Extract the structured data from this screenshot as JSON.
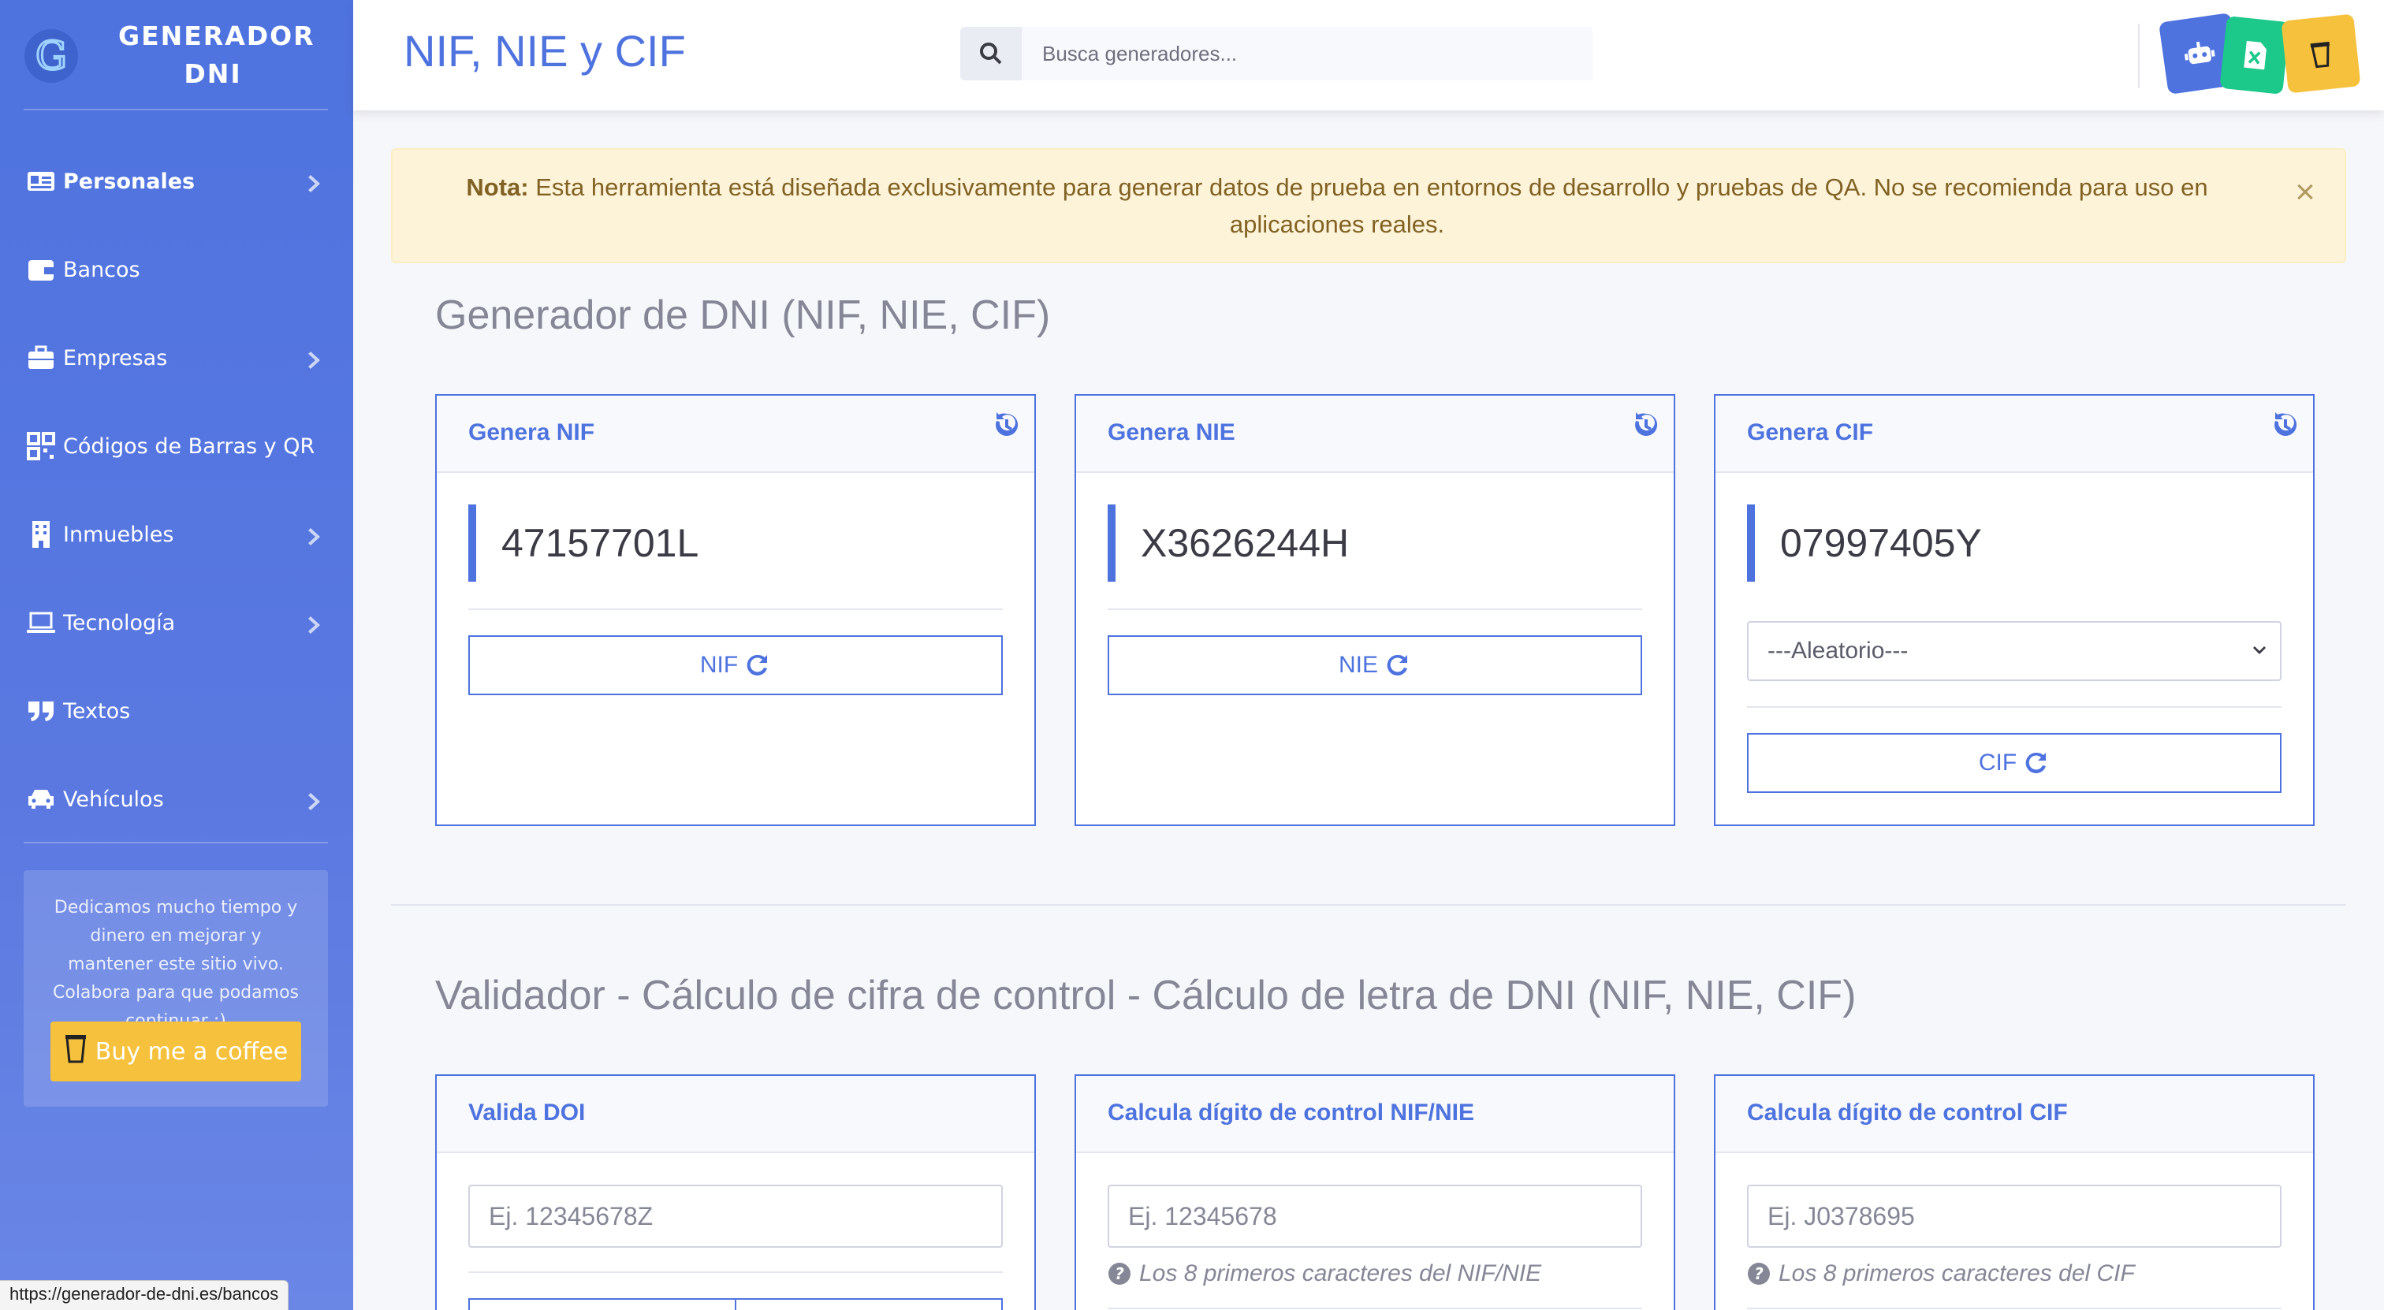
{
  "brand": {
    "name": "GENERADOR DNI"
  },
  "sidebar": {
    "items": [
      {
        "label": "Personales",
        "icon": "id-card-icon",
        "has_submenu": true,
        "active": true
      },
      {
        "label": "Bancos",
        "icon": "wallet-icon",
        "has_submenu": false
      },
      {
        "label": "Empresas",
        "icon": "briefcase-icon",
        "has_submenu": true
      },
      {
        "label": "Códigos de Barras y QR",
        "icon": "qrcode-icon",
        "has_submenu": false
      },
      {
        "label": "Inmuebles",
        "icon": "building-icon",
        "has_submenu": true
      },
      {
        "label": "Tecnología",
        "icon": "laptop-icon",
        "has_submenu": true
      },
      {
        "label": "Textos",
        "icon": "quote-icon",
        "has_submenu": false
      },
      {
        "label": "Vehículos",
        "icon": "car-icon",
        "has_submenu": true
      }
    ],
    "donate_text": "Dedicamos mucho tiempo y dinero en mejorar y mantener este sitio vivo. Colabora para que podamos continuar :)",
    "coffee_label": "Buy me a coffee"
  },
  "header": {
    "title": "NIF, NIE y CIF",
    "search_placeholder": "Busca generadores...",
    "badges": [
      {
        "icon": "robot-icon",
        "color": "#4e73df"
      },
      {
        "icon": "excel-icon",
        "color": "#1cc88a"
      },
      {
        "icon": "coffee-cup-icon",
        "color": "#f6c23e"
      }
    ]
  },
  "alert": {
    "bold": "Nota:",
    "text": " Esta herramienta está diseñada exclusivamente para generar datos de prueba en entornos de desarrollo y pruebas de QA. No se recomienda para uso en aplicaciones reales.",
    "close": "×"
  },
  "generator": {
    "title": "Generador de DNI (NIF, NIE, CIF)",
    "cards": [
      {
        "title": "Genera NIF",
        "value": "47157701L",
        "button": "NIF"
      },
      {
        "title": "Genera NIE",
        "value": "X3626244H",
        "button": "NIE"
      },
      {
        "title": "Genera CIF",
        "value": "07997405Y",
        "select": "---Aleatorio---",
        "button": "CIF"
      }
    ]
  },
  "validator": {
    "title": "Validador - Cálculo de cifra de control - Cálculo de letra de DNI (NIF, NIE, CIF)",
    "cards": [
      {
        "title": "Valida DOI",
        "placeholder": "Ej. 12345678Z"
      },
      {
        "title": "Calcula dígito de control NIF/NIE",
        "placeholder": "Ej. 12345678",
        "help": "Los 8 primeros caracteres del NIF/NIE"
      },
      {
        "title": "Calcula dígito de control CIF",
        "placeholder": "Ej. J0378695",
        "help": "Los 8 primeros caracteres del CIF"
      }
    ]
  },
  "status_bar": {
    "url": "https://generador-de-dni.es/bancos"
  },
  "colors": {
    "primary": "#4e73df",
    "warning": "#f6c23e",
    "success": "#1cc88a"
  }
}
